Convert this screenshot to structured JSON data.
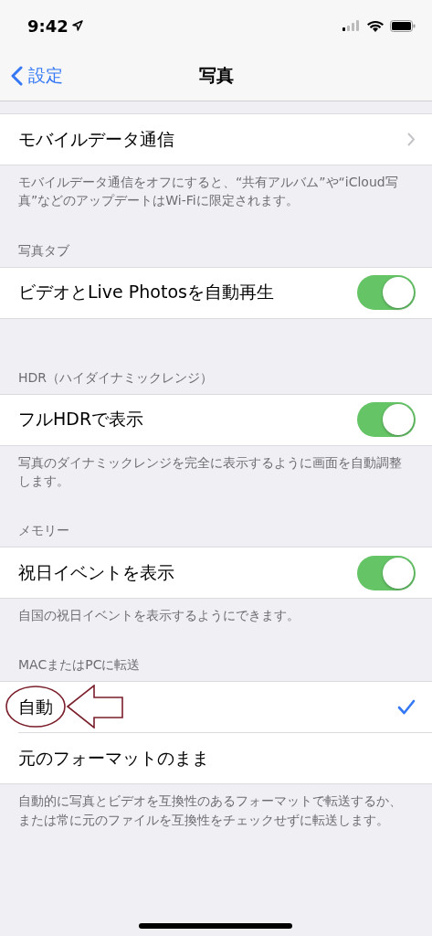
{
  "status_bar": {
    "time": "9:42"
  },
  "nav": {
    "back": "設定",
    "title": "写真"
  },
  "sections": [
    {
      "rows": [
        {
          "kind": "link",
          "label": "モバイルデータ通信"
        }
      ],
      "footer": "モバイルデータ通信をオフにすると、“共有アルバム”や“iCloud写真”などのアップデートはWi-Fiに限定されます。"
    },
    {
      "header": "写真タブ",
      "rows": [
        {
          "kind": "toggle",
          "label": "ビデオとLive Photosを自動再生",
          "on": true
        }
      ]
    },
    {
      "header": "HDR（ハイダイナミックレンジ）",
      "rows": [
        {
          "kind": "toggle",
          "label": "フルHDRで表示",
          "on": true
        }
      ],
      "footer": "写真のダイナミックレンジを完全に表示するように画面を自動調整します。"
    },
    {
      "header": "メモリー",
      "rows": [
        {
          "kind": "toggle",
          "label": "祝日イベントを表示",
          "on": true
        }
      ],
      "footer": "自国の祝日イベントを表示するようにできます。"
    },
    {
      "header": "MACまたはPCに転送",
      "rows": [
        {
          "kind": "option",
          "label": "自動",
          "selected": true,
          "annotated": true
        },
        {
          "kind": "option",
          "label": "元のフォーマットのまま",
          "selected": false
        }
      ],
      "footer": "自動的に写真とビデオを互換性のあるフォーマットで転送するか、または常に元のファイルを互換性をチェックせずに転送します。"
    }
  ]
}
